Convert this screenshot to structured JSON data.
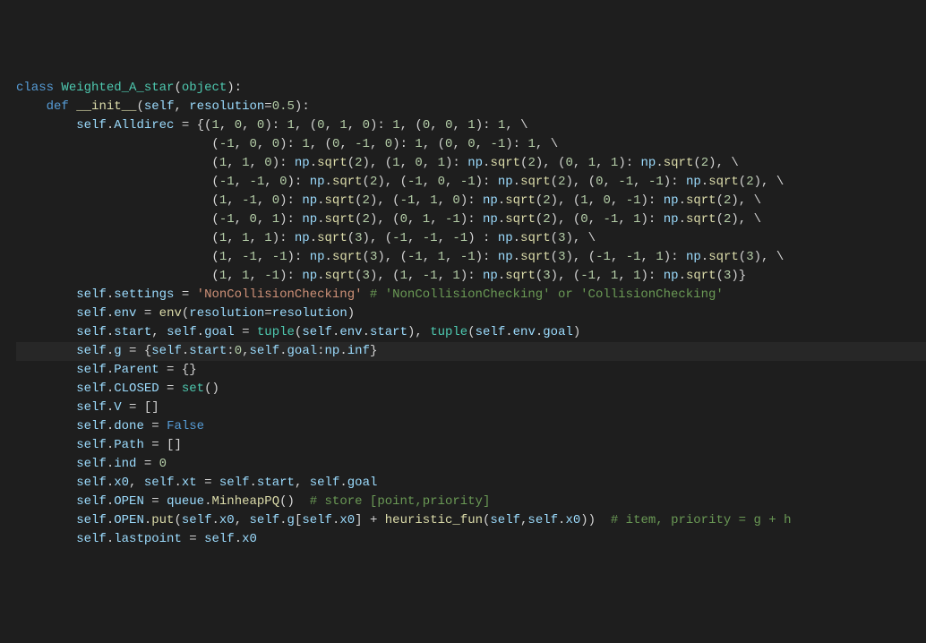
{
  "code": {
    "l01": {
      "a": "class",
      "b": " ",
      "c": "Weighted_A_star",
      "d": "(",
      "e": "object",
      "f": "):"
    },
    "l02": {
      "a": "    ",
      "b": "def",
      "c": " ",
      "d": "__init__",
      "e": "(",
      "f": "self",
      "g": ", ",
      "h": "resolution",
      "i": "=",
      "j": "0.5",
      "k": "):"
    },
    "l03": {
      "a": "        ",
      "b": "self",
      "c": ".",
      "d": "Alldirec",
      "e": " = {(",
      "f": "1",
      "g": ", ",
      "h": "0",
      "i": ", ",
      "j": "0",
      "k": "): ",
      "l": "1",
      "m": ", (",
      "n": "0",
      "o": ", ",
      "p": "1",
      "q": ", ",
      "r": "0",
      "s": "): ",
      "t": "1",
      "u": ", (",
      "v": "0",
      "w": ", ",
      "x": "0",
      "y": ", ",
      "z": "1",
      "aa": "): ",
      "ab": "1",
      "ac": ", \\"
    },
    "l04": {
      "a": "                          (",
      "b": "-1",
      "c": ", ",
      "d": "0",
      "e": ", ",
      "f": "0",
      "g": "): ",
      "h": "1",
      "i": ", (",
      "j": "0",
      "k": ", ",
      "l": "-1",
      "m": ", ",
      "n": "0",
      "o": "): ",
      "p": "1",
      "q": ", (",
      "r": "0",
      "s": ", ",
      "t": "0",
      "u": ", ",
      "v": "-1",
      "w": "): ",
      "x": "1",
      "y": ", \\"
    },
    "l05": {
      "a": "                          (",
      "b": "1",
      "c": ", ",
      "d": "1",
      "e": ", ",
      "f": "0",
      "g": "): ",
      "h": "np",
      "i": ".",
      "j": "sqrt",
      "k": "(",
      "l": "2",
      "m": "), (",
      "n": "1",
      "o": ", ",
      "p": "0",
      "q": ", ",
      "r": "1",
      "s": "): ",
      "t": "np",
      "u": ".",
      "v": "sqrt",
      "w": "(",
      "x": "2",
      "y": "), (",
      "z": "0",
      "aa": ", ",
      "ab": "1",
      "ac": ", ",
      "ad": "1",
      "ae": "): ",
      "af": "np",
      "ag": ".",
      "ah": "sqrt",
      "ai": "(",
      "aj": "2",
      "ak": "), \\"
    },
    "l06": {
      "a": "                          (",
      "b": "-1",
      "c": ", ",
      "d": "-1",
      "e": ", ",
      "f": "0",
      "g": "): ",
      "h": "np",
      "i": ".",
      "j": "sqrt",
      "k": "(",
      "l": "2",
      "m": "), (",
      "n": "-1",
      "o": ", ",
      "p": "0",
      "q": ", ",
      "r": "-1",
      "s": "): ",
      "t": "np",
      "u": ".",
      "v": "sqrt",
      "w": "(",
      "x": "2",
      "y": "), (",
      "z": "0",
      "aa": ", ",
      "ab": "-1",
      "ac": ", ",
      "ad": "-1",
      "ae": "): ",
      "af": "np",
      "ag": ".",
      "ah": "sqrt",
      "ai": "(",
      "aj": "2",
      "ak": "), \\"
    },
    "l07": {
      "a": "                          (",
      "b": "1",
      "c": ", ",
      "d": "-1",
      "e": ", ",
      "f": "0",
      "g": "): ",
      "h": "np",
      "i": ".",
      "j": "sqrt",
      "k": "(",
      "l": "2",
      "m": "), (",
      "n": "-1",
      "o": ", ",
      "p": "1",
      "q": ", ",
      "r": "0",
      "s": "): ",
      "t": "np",
      "u": ".",
      "v": "sqrt",
      "w": "(",
      "x": "2",
      "y": "), (",
      "z": "1",
      "aa": ", ",
      "ab": "0",
      "ac": ", ",
      "ad": "-1",
      "ae": "): ",
      "af": "np",
      "ag": ".",
      "ah": "sqrt",
      "ai": "(",
      "aj": "2",
      "ak": "), \\"
    },
    "l08": {
      "a": "                          (",
      "b": "-1",
      "c": ", ",
      "d": "0",
      "e": ", ",
      "f": "1",
      "g": "): ",
      "h": "np",
      "i": ".",
      "j": "sqrt",
      "k": "(",
      "l": "2",
      "m": "), (",
      "n": "0",
      "o": ", ",
      "p": "1",
      "q": ", ",
      "r": "-1",
      "s": "): ",
      "t": "np",
      "u": ".",
      "v": "sqrt",
      "w": "(",
      "x": "2",
      "y": "), (",
      "z": "0",
      "aa": ", ",
      "ab": "-1",
      "ac": ", ",
      "ad": "1",
      "ae": "): ",
      "af": "np",
      "ag": ".",
      "ah": "sqrt",
      "ai": "(",
      "aj": "2",
      "ak": "), \\"
    },
    "l09": {
      "a": "                          (",
      "b": "1",
      "c": ", ",
      "d": "1",
      "e": ", ",
      "f": "1",
      "g": "): ",
      "h": "np",
      "i": ".",
      "j": "sqrt",
      "k": "(",
      "l": "3",
      "m": "), (",
      "n": "-1",
      "o": ", ",
      "p": "-1",
      "q": ", ",
      "r": "-1",
      "s": ") : ",
      "t": "np",
      "u": ".",
      "v": "sqrt",
      "w": "(",
      "x": "3",
      "y": "), \\"
    },
    "l10": {
      "a": "                          (",
      "b": "1",
      "c": ", ",
      "d": "-1",
      "e": ", ",
      "f": "-1",
      "g": "): ",
      "h": "np",
      "i": ".",
      "j": "sqrt",
      "k": "(",
      "l": "3",
      "m": "), (",
      "n": "-1",
      "o": ", ",
      "p": "1",
      "q": ", ",
      "r": "-1",
      "s": "): ",
      "t": "np",
      "u": ".",
      "v": "sqrt",
      "w": "(",
      "x": "3",
      "y": "), (",
      "z": "-1",
      "aa": ", ",
      "ab": "-1",
      "ac": ", ",
      "ad": "1",
      "ae": "): ",
      "af": "np",
      "ag": ".",
      "ah": "sqrt",
      "ai": "(",
      "aj": "3",
      "ak": "), \\"
    },
    "l11": {
      "a": "                          (",
      "b": "1",
      "c": ", ",
      "d": "1",
      "e": ", ",
      "f": "-1",
      "g": "): ",
      "h": "np",
      "i": ".",
      "j": "sqrt",
      "k": "(",
      "l": "3",
      "m": "), (",
      "n": "1",
      "o": ", ",
      "p": "-1",
      "q": ", ",
      "r": "1",
      "s": "): ",
      "t": "np",
      "u": ".",
      "v": "sqrt",
      "w": "(",
      "x": "3",
      "y": "), (",
      "z": "-1",
      "aa": ", ",
      "ab": "1",
      "ac": ", ",
      "ad": "1",
      "ae": "): ",
      "af": "np",
      "ag": ".",
      "ah": "sqrt",
      "ai": "(",
      "aj": "3",
      "ak": ")}"
    },
    "l12": {
      "a": "        ",
      "b": "self",
      "c": ".",
      "d": "settings",
      "e": " = ",
      "f": "'NonCollisionChecking'",
      "g": " ",
      "h": "# 'NonCollisionChecking' or 'CollisionChecking'"
    },
    "l13": {
      "a": "        ",
      "b": "self",
      "c": ".",
      "d": "env",
      "e": " = ",
      "f": "env",
      "g": "(",
      "h": "resolution",
      "i": "=",
      "j": "resolution",
      "k": ")"
    },
    "l14": {
      "a": "        ",
      "b": "self",
      "c": ".",
      "d": "start",
      "e": ", ",
      "f": "self",
      "g": ".",
      "h": "goal",
      "i": " = ",
      "j": "tuple",
      "k": "(",
      "l": "self",
      "m": ".",
      "n": "env",
      "o": ".",
      "p": "start",
      "q": "), ",
      "r": "tuple",
      "s": "(",
      "t": "self",
      "u": ".",
      "v": "env",
      "w": ".",
      "x": "goal",
      "y": ")"
    },
    "l15": {
      "a": "        ",
      "b": "self",
      "c": ".",
      "d": "g",
      "e": " = {",
      "f": "self",
      "g": ".",
      "h": "start",
      "i": ":",
      "j": "0",
      "k": ",",
      "l": "self",
      "m": ".",
      "n": "goal",
      "o": ":",
      "p": "np",
      "q": ".",
      "r": "inf",
      "s": "}"
    },
    "l16": {
      "a": "        ",
      "b": "self",
      "c": ".",
      "d": "Parent",
      "e": " = {}"
    },
    "l17": {
      "a": "        ",
      "b": "self",
      "c": ".",
      "d": "CLOSED",
      "e": " = ",
      "f": "set",
      "g": "()"
    },
    "l18": {
      "a": "        ",
      "b": "self",
      "c": ".",
      "d": "V",
      "e": " = []"
    },
    "l19": {
      "a": "        ",
      "b": "self",
      "c": ".",
      "d": "done",
      "e": " = ",
      "f": "False"
    },
    "l20": {
      "a": "        ",
      "b": "self",
      "c": ".",
      "d": "Path",
      "e": " = []"
    },
    "l21": {
      "a": "        ",
      "b": "self",
      "c": ".",
      "d": "ind",
      "e": " = ",
      "f": "0"
    },
    "l22": {
      "a": "        ",
      "b": "self",
      "c": ".",
      "d": "x0",
      "e": ", ",
      "f": "self",
      "g": ".",
      "h": "xt",
      "i": " = ",
      "j": "self",
      "k": ".",
      "l": "start",
      "m": ", ",
      "n": "self",
      "o": ".",
      "p": "goal"
    },
    "l23": {
      "a": "        ",
      "b": "self",
      "c": ".",
      "d": "OPEN",
      "e": " = ",
      "f": "queue",
      "g": ".",
      "h": "MinheapPQ",
      "i": "()  ",
      "j": "# store [point,priority]"
    },
    "l24": {
      "a": "        ",
      "b": "self",
      "c": ".",
      "d": "OPEN",
      "e": ".",
      "f": "put",
      "g": "(",
      "h": "self",
      "i": ".",
      "j": "x0",
      "k": ", ",
      "l": "self",
      "m": ".",
      "n": "g",
      "o": "[",
      "p": "self",
      "q": ".",
      "r": "x0",
      "s": "] + ",
      "t": "heuristic_fun",
      "u": "(",
      "v": "self",
      "w": ",",
      "x": "self",
      "y": ".",
      "z": "x0",
      "aa": "))  ",
      "ab": "# item, priority = g + h"
    },
    "l25": {
      "a": "        ",
      "b": "self",
      "c": ".",
      "d": "lastpoint",
      "e": " = ",
      "f": "self",
      "g": ".",
      "h": "x0"
    }
  }
}
